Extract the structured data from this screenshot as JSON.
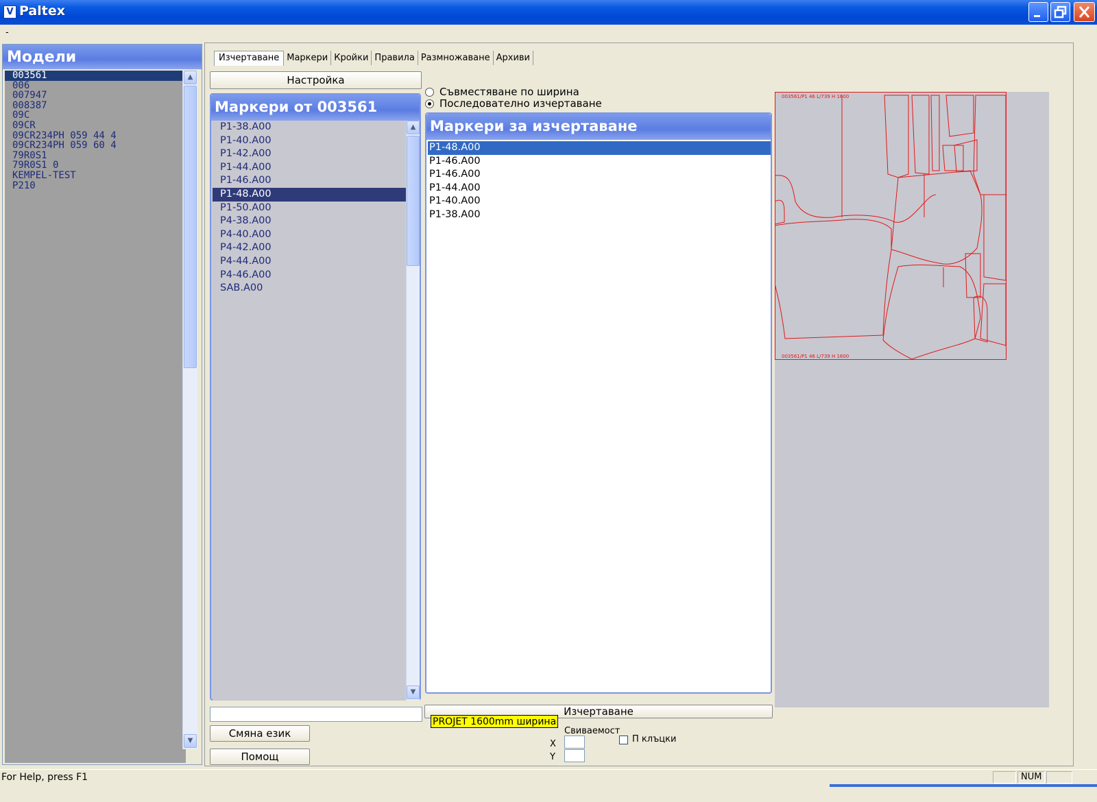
{
  "window": {
    "title": "Paltex",
    "icon": "V",
    "minimize_icon": "minimize-icon",
    "maximize_icon": "restore-icon",
    "close_icon": "close-icon"
  },
  "menu_stub": "-",
  "models": {
    "header": "Модели",
    "items": [
      "003561",
      "006",
      "007947",
      "008387",
      "09C",
      "09CR",
      "09CR234PH 059 44 4",
      "09CR234PH 059 60 4",
      "79R0S1",
      "79R0S1 0",
      "KEMPEL-TEST",
      "P210"
    ],
    "selected_index": 0
  },
  "tabs": [
    "Изчертаване",
    "Маркери",
    "Кройки",
    "Правила",
    "Размножаване",
    "Архиви"
  ],
  "active_tab": 0,
  "setup_button": "Настройка",
  "markers": {
    "header": "Маркери от 003561",
    "items": [
      "P1-38.A00",
      "P1-40.A00",
      "P1-42.A00",
      "P1-44.A00",
      "P1-46.A00",
      "P1-48.A00",
      "P1-50.A00",
      "P4-38.A00",
      "P4-40.A00",
      "P4-42.A00",
      "P4-44.A00",
      "P4-46.A00",
      "SAB.A00"
    ],
    "selected_index": 5
  },
  "radio": {
    "option1": "Съвместяване по ширина",
    "option2": "Последователно изчертаване",
    "selected": 2
  },
  "plot": {
    "header": "Маркери за изчертаване",
    "items": [
      "P1-48.A00",
      "P1-46.A00",
      "P1-46.A00",
      "P1-44.A00",
      "P1-40.A00",
      "P1-38.A00"
    ],
    "selected_index": 0
  },
  "preview": {
    "top_label": "003561/P1 46 L/739 H 1600",
    "bottom_label": "003561/P1 46 L/739 H 1600",
    "line_color": "#e01818"
  },
  "plot_button": "Изчертаване",
  "tooltip": "PROJET 1600mm ширина",
  "lang_button": "Смяна език",
  "help_button": "Помощ",
  "stretch_label": "Свиваемост",
  "x_label": "X",
  "y_label": "Y",
  "x_value": "",
  "y_value": "",
  "buttons_check_label": "П клъцки",
  "buttons_checked": false,
  "status": {
    "help_text": "For Help, press F1",
    "num": "NUM"
  }
}
